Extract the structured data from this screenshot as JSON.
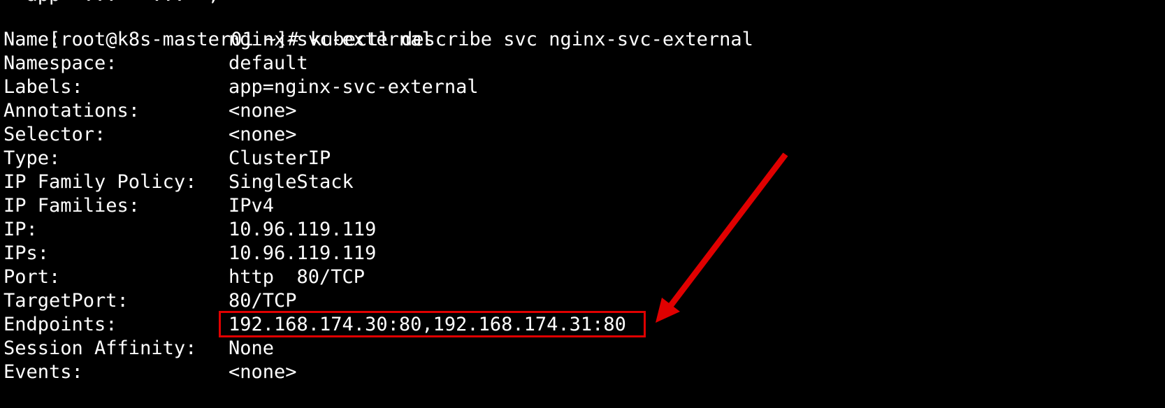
{
  "terminal": {
    "prev_output_fragment": "' app' ... ' ... ',",
    "prompt": "[root@k8s-master01 ~]#",
    "command": "kubectl describe svc nginx-svc-external",
    "rows": [
      {
        "key": "Name:",
        "value": "nginx-svc-external"
      },
      {
        "key": "Namespace:",
        "value": "default"
      },
      {
        "key": "Labels:",
        "value": "app=nginx-svc-external"
      },
      {
        "key": "Annotations:",
        "value": "<none>"
      },
      {
        "key": "Selector:",
        "value": "<none>"
      },
      {
        "key": "Type:",
        "value": "ClusterIP"
      },
      {
        "key": "IP Family Policy:",
        "value": "SingleStack"
      },
      {
        "key": "IP Families:",
        "value": "IPv4"
      },
      {
        "key": "IP:",
        "value": "10.96.119.119"
      },
      {
        "key": "IPs:",
        "value": "10.96.119.119"
      },
      {
        "key": "Port:",
        "value": "http  80/TCP"
      },
      {
        "key": "TargetPort:",
        "value": "80/TCP"
      },
      {
        "key": "Endpoints:",
        "value": "192.168.174.30:80,192.168.174.31:80"
      },
      {
        "key": "Session Affinity:",
        "value": "None"
      },
      {
        "key": "Events:",
        "value": "<none>"
      }
    ]
  },
  "annotation": {
    "highlight_color": "#e00000",
    "highlighted_field": "Endpoints:"
  },
  "colors": {
    "background": "#000000",
    "text": "#ffffff"
  }
}
